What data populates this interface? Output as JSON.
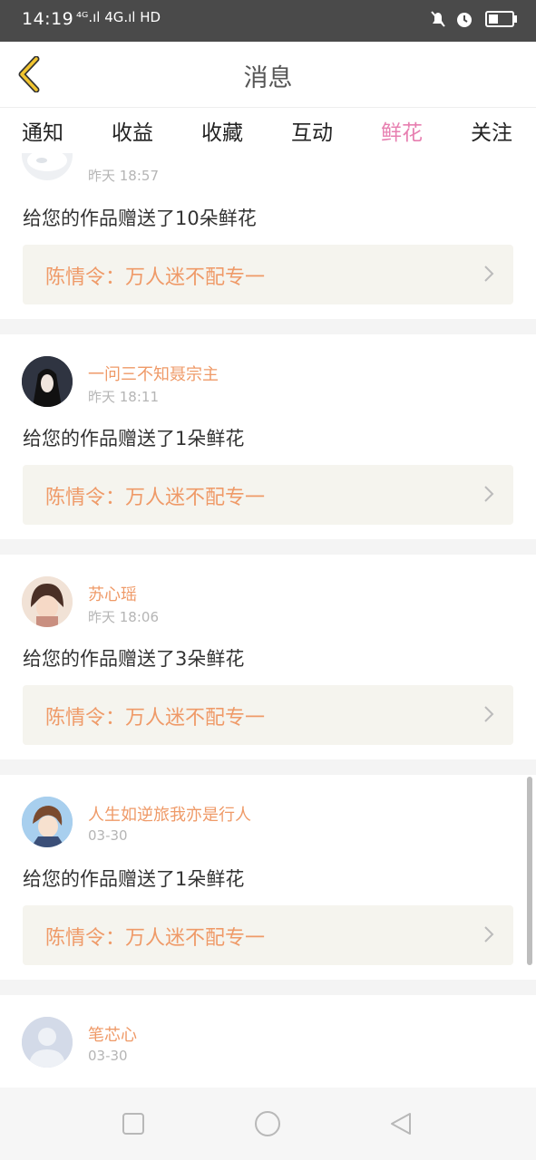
{
  "status_bar": {
    "time": "14:19",
    "network": "⁴ᴳ.ıl 4G.ıl HD",
    "right_icons": [
      "bell-muted-icon",
      "alarm-icon",
      "battery-icon"
    ]
  },
  "header": {
    "title": "消息",
    "back_icon": "chevron-left-icon"
  },
  "tabs": [
    {
      "label": "通知"
    },
    {
      "label": "收益"
    },
    {
      "label": "收藏"
    },
    {
      "label": "互动"
    },
    {
      "label": "鲜花",
      "active": true
    },
    {
      "label": "关注"
    }
  ],
  "messages": [
    {
      "user": "",
      "time": "昨天 18:57",
      "text": "给您的作品赠送了10朵鲜花",
      "work": "陈情令：万人迷不配专一"
    },
    {
      "user": "一问三不知聂宗主",
      "time": "昨天 18:11",
      "text": "给您的作品赠送了1朵鲜花",
      "work": "陈情令：万人迷不配专一"
    },
    {
      "user": "苏心瑶",
      "time": "昨天 18:06",
      "text": "给您的作品赠送了3朵鲜花",
      "work": "陈情令：万人迷不配专一"
    },
    {
      "user": "人生如逆旅我亦是行人",
      "time": "03-30",
      "text": "给您的作品赠送了1朵鲜花",
      "work": "陈情令：万人迷不配专一"
    },
    {
      "user": "笔芯心",
      "time": "03-30"
    }
  ],
  "colors": {
    "accent_pink": "#e77fb0",
    "username_orange": "#ef9a68",
    "link_background": "#f5f4ee",
    "back_chevron_yellow": "#f2c530"
  },
  "nav_bar": {
    "icons": [
      "square-icon",
      "circle-icon",
      "triangle-back-icon"
    ]
  }
}
